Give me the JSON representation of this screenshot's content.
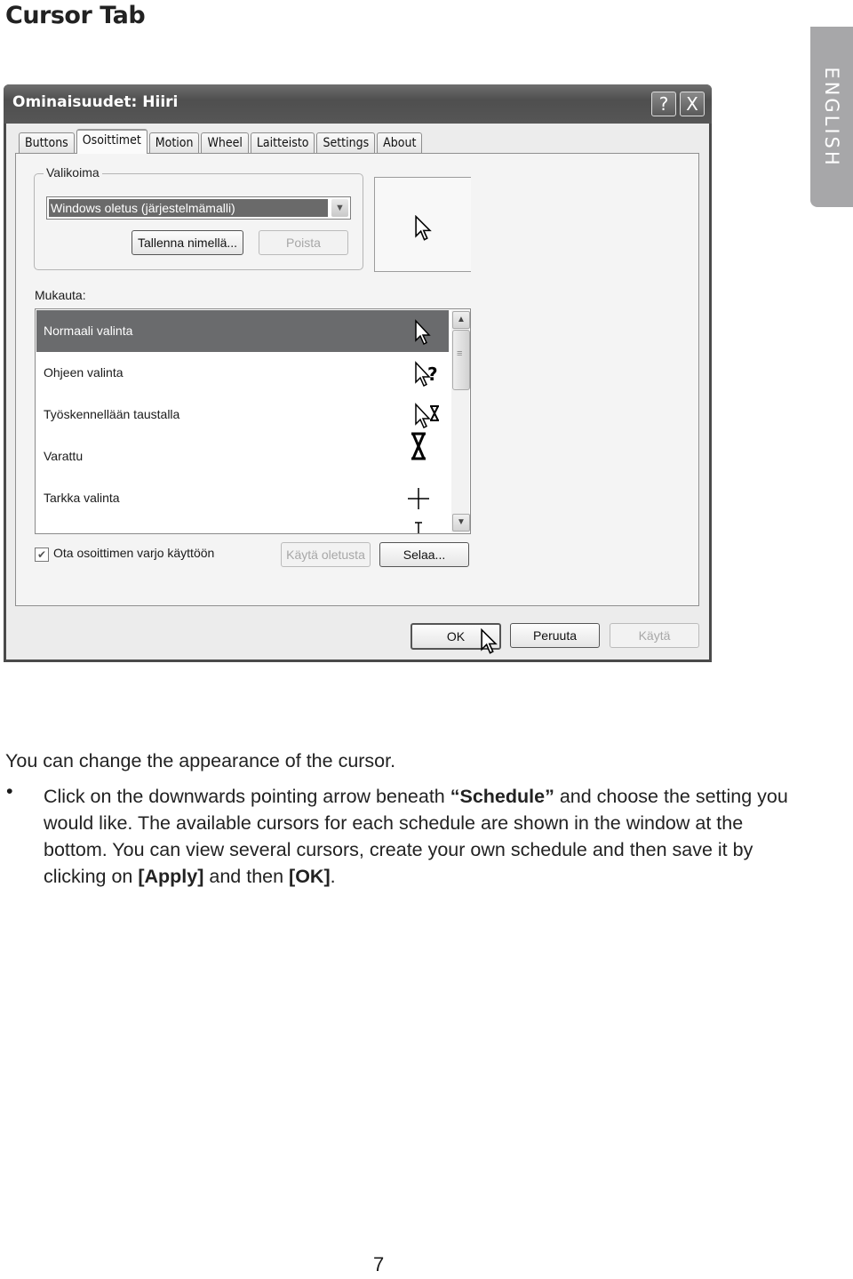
{
  "page": {
    "title": "Cursor Tab",
    "side_tab": "ENGLISH",
    "page_number": "7"
  },
  "dialog": {
    "title": "Ominaisuudet: Hiiri",
    "title_buttons": {
      "help": "?",
      "close": "X"
    },
    "tabs": [
      {
        "label": "Buttons",
        "active": false
      },
      {
        "label": "Osoittimet",
        "active": true
      },
      {
        "label": "Motion",
        "active": false
      },
      {
        "label": "Wheel",
        "active": false
      },
      {
        "label": "Laitteisto",
        "active": false
      },
      {
        "label": "Settings",
        "active": false
      },
      {
        "label": "About",
        "active": false
      }
    ],
    "scheme_group": {
      "legend": "Valikoima",
      "selected_scheme": "Windows oletus (järjestelmämalli)",
      "save_as_button": "Tallenna nimellä...",
      "delete_button": "Poista"
    },
    "customize_label": "Mukauta:",
    "cursor_list": [
      {
        "label": "Normaali valinta",
        "icon": "arrow-cursor-icon",
        "selected": true
      },
      {
        "label": "Ohjeen valinta",
        "icon": "help-cursor-icon",
        "selected": false
      },
      {
        "label": "Työskennellään taustalla",
        "icon": "working-cursor-icon",
        "selected": false
      },
      {
        "label": "Varattu",
        "icon": "hourglass-cursor-icon",
        "selected": false
      },
      {
        "label": "Tarkka valinta",
        "icon": "crosshair-cursor-icon",
        "selected": false
      },
      {
        "label": "",
        "icon": "text-cursor-icon",
        "selected": false
      }
    ],
    "shadow_checkbox": {
      "label": "Ota osoittimen varjo käyttöön",
      "checked": true
    },
    "use_default_button": "Käytä oletusta",
    "browse_button": "Selaa...",
    "footer": {
      "ok": "OK",
      "cancel": "Peruuta",
      "apply": "Käytä"
    }
  },
  "body": {
    "intro": "You can change the appearance of the cursor.",
    "bullet_parts": [
      {
        "text": "Click on the downwards pointing arrow beneath ",
        "bold": false
      },
      {
        "text": "“Schedule”",
        "bold": true
      },
      {
        "text": " and choose the setting you would like. The available cursors for each schedule are shown in the window at the bottom. You can view several cursors, create your own schedule and then save it by clicking on ",
        "bold": false
      },
      {
        "text": "[Apply]",
        "bold": true
      },
      {
        "text": " and then ",
        "bold": false
      },
      {
        "text": "[OK]",
        "bold": true
      },
      {
        "text": ".",
        "bold": false
      }
    ]
  }
}
